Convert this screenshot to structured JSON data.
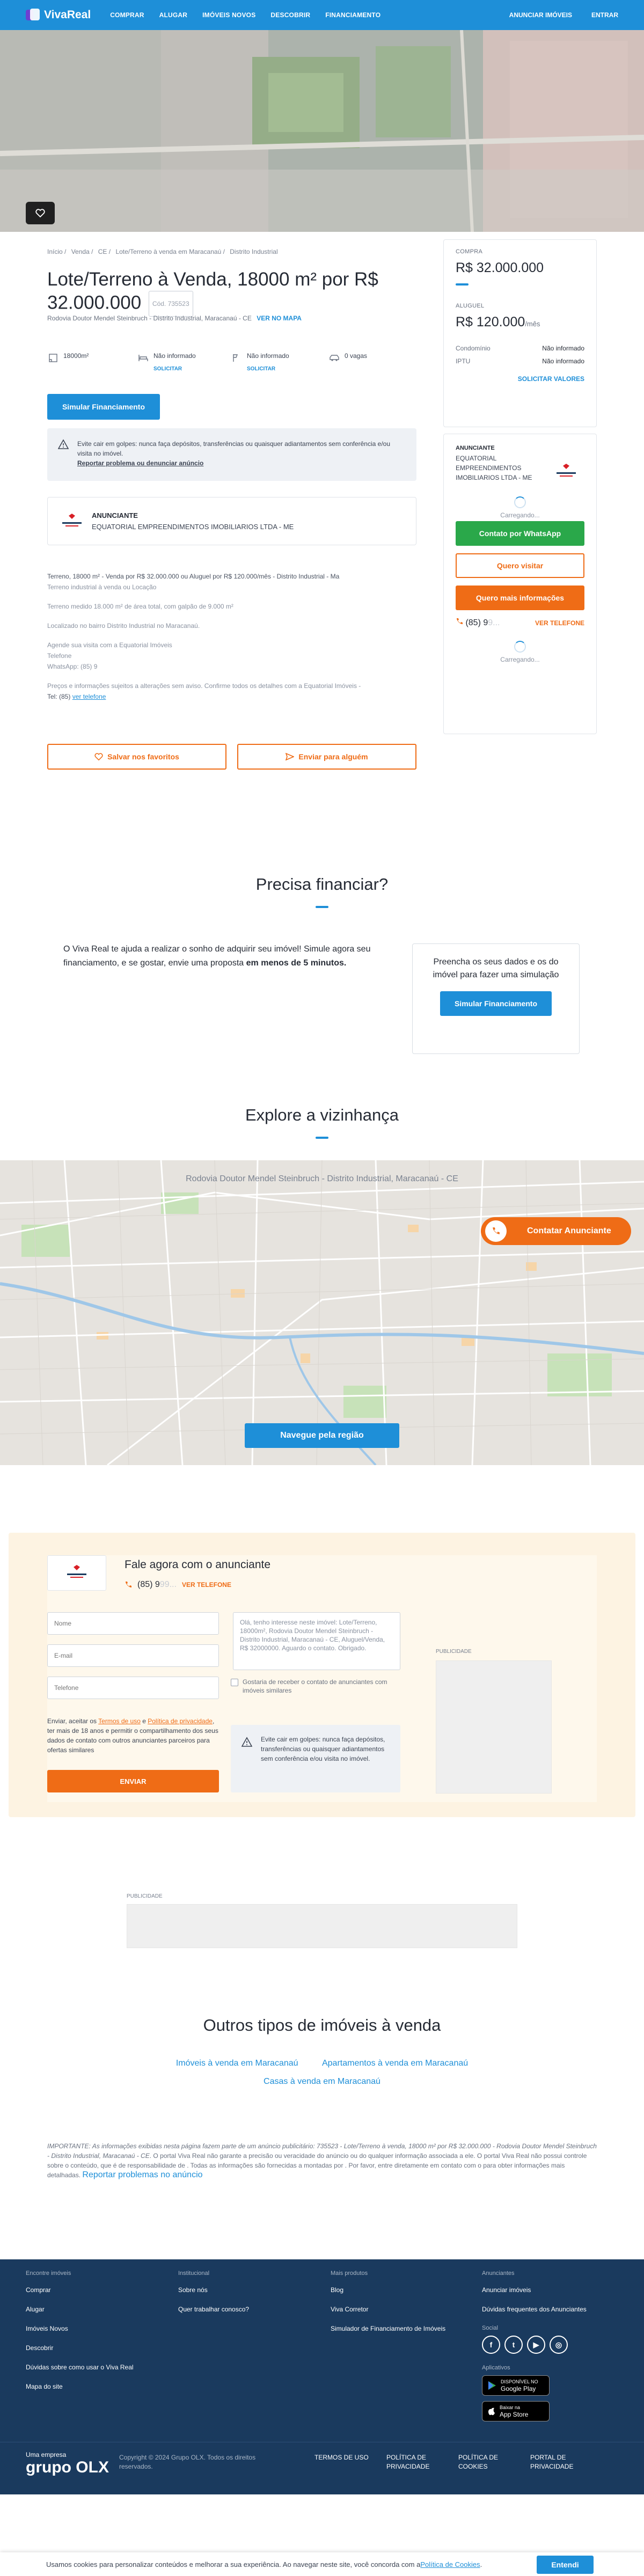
{
  "header": {
    "brand": "VivaReal",
    "nav": [
      "COMPRAR",
      "ALUGAR",
      "IMÓVEIS NOVOS",
      "DESCOBRIR",
      "FINANCIAMENTO"
    ],
    "advertise": "ANUNCIAR IMÓVEIS",
    "login": "ENTRAR"
  },
  "breadcrumb": [
    "Início /",
    "Venda /",
    "CE /",
    "Lote/Terreno à venda em Maracanaú /",
    "Distrito Industrial"
  ],
  "listing": {
    "title": "Lote/Terreno à Venda, 18000 m² por R$ 32.000.000",
    "code": "Cód. 735523",
    "address": "Rodovia Doutor Mendel Steinbruch - Distrito Industrial, Maracanaú - CE",
    "map_link": "VER NO MAPA",
    "amenities": [
      {
        "icon": "area-icon",
        "value": "18000m²",
        "action": ""
      },
      {
        "icon": "bed-icon",
        "value": "Não informado",
        "action": "SOLICITAR"
      },
      {
        "icon": "bath-icon",
        "value": "Não informado",
        "action": "SOLICITAR"
      },
      {
        "icon": "car-icon",
        "value": "0 vagas",
        "action": ""
      }
    ],
    "simulate": "Simular Financiamento",
    "alert_text": "Evite cair em golpes: nunca faça depósitos, transferências ou quaisquer adiantamentos sem conferência e/ou visita no imóvel.",
    "alert_link": "Reportar problema ou denunciar anúncio",
    "advertiser_label": "ANUNCIANTE",
    "advertiser_name": "EQUATORIAL EMPREENDIMENTOS IMOBILIARIOS LTDA - ME",
    "description": [
      "Terreno, 18000 m² - Venda por R$ 32.000.000 ou Aluguel por R$ 120.000/mês - Distrito Industrial - Ma",
      "Terreno industrial à venda ou Locação",
      "Terreno medido 18.000 m² de área total, com galpão de 9.000 m²",
      "Localizado no bairro Distrito Industrial no Maracanaú.",
      "Agende sua visita com a Equatorial Imóveis",
      "Telefone",
      "WhatsApp: (85) 9",
      "Preços e informações sujeitos a alterações sem aviso. Confirme todos os detalhes com a Equatorial Imóveis -",
      "Tel: (85)"
    ],
    "see_phone": "ver telefone",
    "save": "Salvar nos favoritos",
    "share": "Enviar para alguém"
  },
  "prices": {
    "buy_label": "COMPRA",
    "buy_value": "R$ 32.000.000",
    "rent_label": "ALUGUEL",
    "rent_value": "R$ 120.000",
    "rent_suffix": "/mês",
    "condo_label": "Condomínio",
    "condo_value": "Não informado",
    "iptu_label": "IPTU",
    "iptu_value": "Não informado",
    "request": "SOLICITAR VALORES"
  },
  "contact": {
    "label": "ANUNCIANTE",
    "name": "EQUATORIAL EMPREENDIMENTOS IMOBILIARIOS LTDA - ME",
    "loading": "Carregando...",
    "whatsapp": "Contato por WhatsApp",
    "visit": "Quero visitar",
    "info": "Quero mais informações",
    "phone_prefix": "(85) 9",
    "phone_blur": "9...",
    "see_phone": "VER TELEFONE"
  },
  "financing": {
    "title": "Precisa financiar?",
    "text": "O Viva Real te ajuda a realizar o sonho de adquirir seu imóvel! Simule agora seu financiamento, e se gostar, envie uma proposta ",
    "text_bold": "em menos de 5 minutos.",
    "card_text": "Preencha os seus dados e os do imóvel para fazer uma simulação",
    "card_button": "Simular Financiamento"
  },
  "neighborhood": {
    "title": "Explore a vizinhança",
    "address": "Rodovia Doutor Mendel Steinbruch - Distrito Industrial, Maracanaú - CE",
    "contact": "Contatar Anunciante",
    "navigate": "Navegue pela região"
  },
  "form": {
    "title": "Fale agora com o anunciante",
    "phone_prefix": "(85) 9",
    "phone_blur": "99...",
    "see_phone": "VER TELEFONE",
    "name_ph": "Nome",
    "email_ph": "E-mail",
    "phone_ph": "Telefone",
    "message": "Olá, tenho interesse neste imóvel: Lote/Terreno, 18000m², Rodovia Doutor Mendel Steinbruch - Distrito Industrial, Maracanaú - CE, Aluguel/Venda, R$ 32000000. Aguardo o contato. Obrigado.",
    "similar": "Gostaria de receber o contato de anunciantes com imóveis similares",
    "terms_a": "Enviar, aceitar os ",
    "terms_link1": "Termos de uso",
    "terms_b": " e ",
    "terms_link2": "Política de privacidade",
    "terms_c": ", ter mais de 18 anos e permitir o compartilhamento dos seus dados de contato com outros anunciantes parceiros para ofertas similares",
    "send": "ENVIAR",
    "alert": "Evite cair em golpes: nunca faça depósitos, transferências ou quaisquer adiantamentos sem conferência e/ou visita no imóvel.",
    "ad_label": "PUBLICIDADE"
  },
  "ad2": "PUBLICIDADE",
  "others": {
    "title": "Outros tipos de imóveis à venda",
    "links": [
      "Imóveis à venda em Maracanaú",
      "Apartamentos à venda em Maracanaú",
      "Casas à venda em Maracanaú"
    ]
  },
  "disclaimer": {
    "a": "IMPORTANTE: ",
    "b": "As informações exibidas nesta página fazem parte de um anúncio publicitário: ",
    "c": "735523 - Lote/Terreno à venda, 18000 m² por R$ 32.000.000 - Rodovia Doutor Mendel Steinbruch - Distrito Industrial, Maracanaú - CE",
    "d": ". O portal Viva Real não garante a precisão ou veracidade do anúncio ou do qualquer informação associada a ele. O portal Viva Real não possui controle sobre o conteúdo, que é de responsabilidade de . Todas as informações são fornecidas a montadas por . Por favor, entre diretamente em contato com o para obter informações mais detalhadas. ",
    "link": "Reportar problemas no anúncio"
  },
  "footer": {
    "cols": [
      {
        "title": "Encontre imóveis",
        "links": [
          "Comprar",
          "Alugar",
          "Imóveis Novos",
          "Descobrir",
          "Dúvidas sobre como usar o Viva Real",
          "Mapa do site"
        ]
      },
      {
        "title": "Institucional",
        "links": [
          "Sobre nós",
          "Quer trabalhar conosco?"
        ]
      },
      {
        "title": "Mais produtos",
        "links": [
          "Blog",
          "Viva Corretor",
          "Simulador de Financiamento de Imóveis"
        ]
      },
      {
        "title": "Anunciantes",
        "links": [
          "Anunciar imóveis",
          "Dúvidas frequentes dos Anunciantes"
        ]
      }
    ],
    "social_label": "Social",
    "apps_label": "Aplicativos",
    "google_small": "DISPONÍVEL NO",
    "google": "Google Play",
    "apple_small": "Baixar na",
    "apple": "App Store",
    "group_small": "Uma empresa",
    "group": "grupo OLX",
    "copyright": "Copyright © 2024 Grupo OLX. Todos os direitos reservados.",
    "legal": [
      "TERMOS DE USO",
      "POLÍTICA DE PRIVACIDADE",
      "POLÍTICA DE COOKIES",
      "PORTAL DE PRIVACIDADE"
    ]
  },
  "cookie": {
    "text": "Usamos cookies para personalizar conteúdos e melhorar a sua experiência. Ao navegar neste site, você concorda com a ",
    "link": "Política de Cookies",
    "after": ".",
    "button": "Entendi"
  },
  "colors": {
    "primary": "#1e8fd8",
    "orange": "#ef6c16",
    "green": "#2aa84a",
    "footer": "#1a3a5e"
  }
}
